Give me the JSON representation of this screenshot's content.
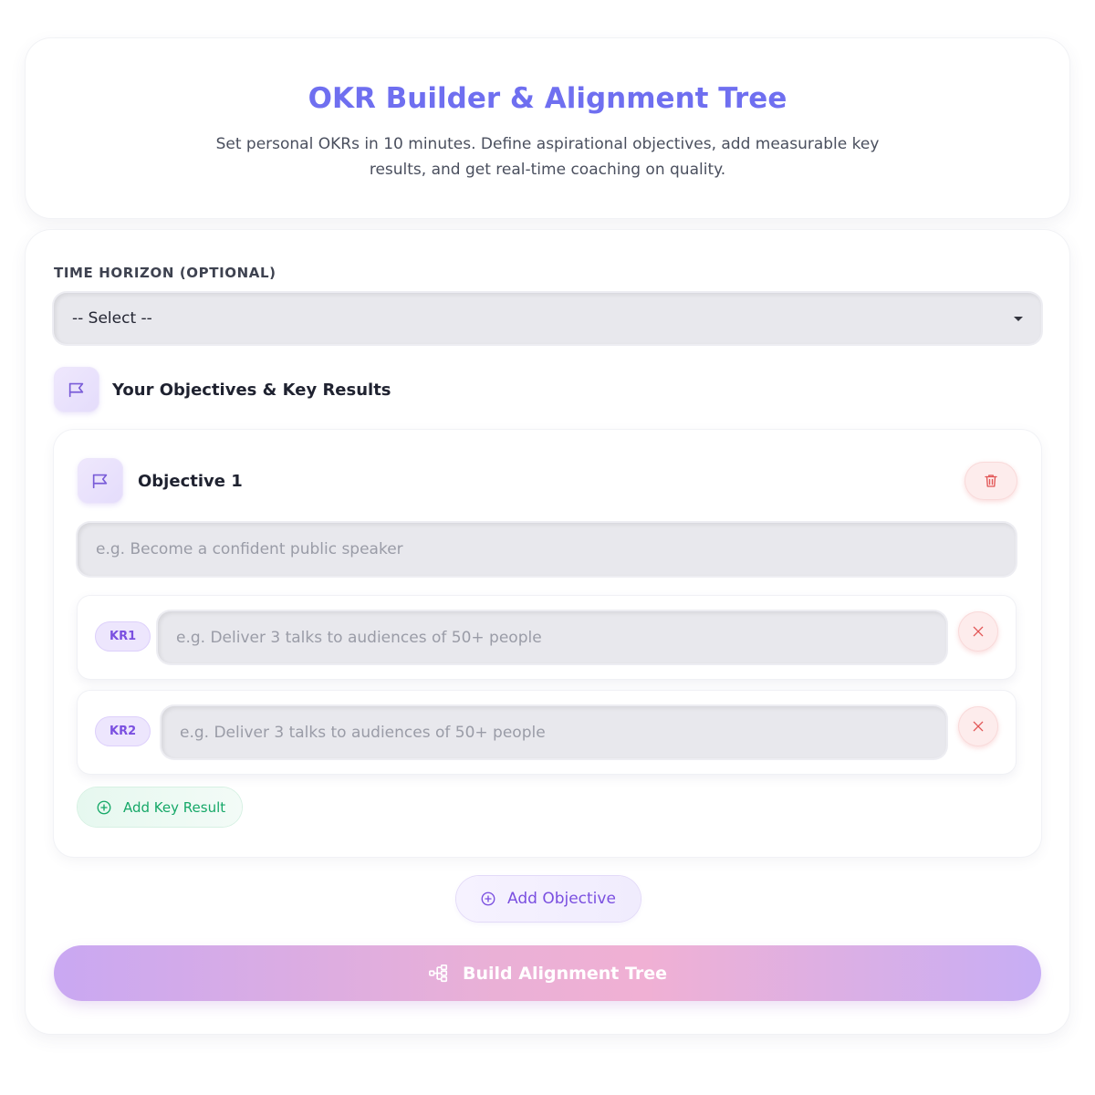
{
  "header": {
    "title": "OKR Builder & Alignment Tree",
    "subtitle": "Set personal OKRs in 10 minutes. Define aspirational objectives, add measurable key results, and get real-time coaching on quality."
  },
  "time_horizon": {
    "label": "TIME HORIZON (OPTIONAL)",
    "selected": "-- Select --"
  },
  "section": {
    "title": "Your Objectives & Key Results"
  },
  "objective": {
    "title": "Objective 1",
    "placeholder": "e.g. Become a confident public speaker",
    "key_results": [
      {
        "badge": "KR1",
        "placeholder": "e.g. Deliver 3 talks to audiences of 50+ people"
      },
      {
        "badge": "KR2",
        "placeholder": "e.g. Deliver 3 talks to audiences of 50+ people"
      }
    ],
    "add_kr_label": "Add Key Result"
  },
  "actions": {
    "add_objective_label": "Add Objective",
    "build_label": "Build Alignment Tree"
  },
  "icons": {
    "flag": "flag-icon",
    "trash": "trash-icon",
    "close": "close-icon",
    "plus_circle": "plus-circle-icon",
    "tree": "tree-icon",
    "caret": "caret-down-icon"
  },
  "colors": {
    "accent": "#6f6ff0",
    "purple": "#7a4fe0",
    "green": "#16a868",
    "danger": "#e25555"
  }
}
